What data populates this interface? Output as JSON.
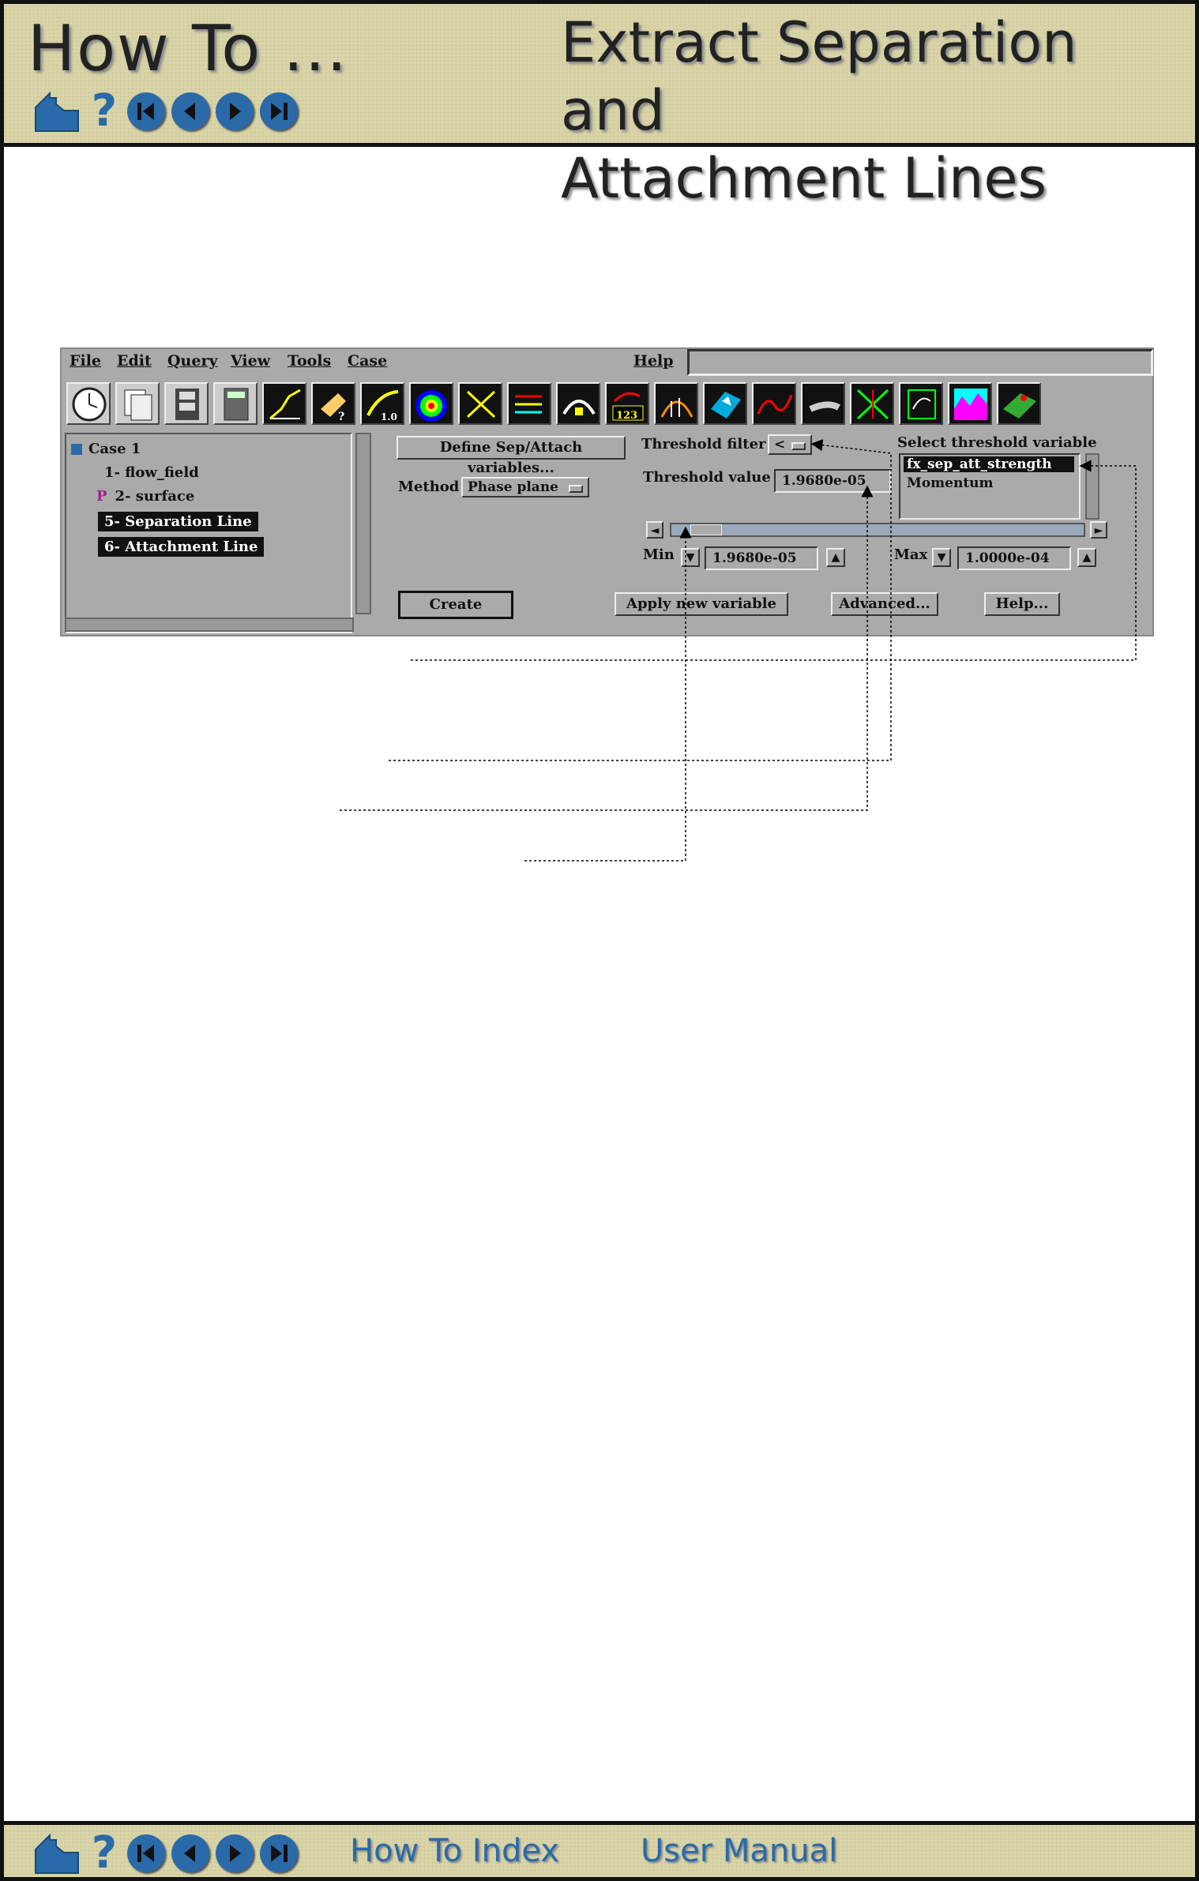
{
  "header": {
    "left_title": "How To ...",
    "right_title_line1": "Extract Separation and",
    "right_title_line2": "Attachment Lines",
    "nav_icons": [
      "home-icon",
      "help-icon",
      "first-page-icon",
      "previous-page-icon",
      "next-page-icon",
      "last-page-icon"
    ]
  },
  "footer": {
    "links": [
      "How To Index",
      "User Manual"
    ]
  },
  "gui": {
    "menus": [
      "File",
      "Edit",
      "Query",
      "View",
      "Tools",
      "Case",
      "Help"
    ],
    "tree": {
      "case": "Case 1",
      "items": [
        {
          "label": "1- flow_field",
          "prefix": ""
        },
        {
          "label": "2- surface",
          "prefix": "P"
        },
        {
          "label": "5- Separation Line",
          "prefix": ""
        },
        {
          "label": "6- Attachment Line",
          "prefix": ""
        }
      ]
    },
    "define_button": "Define Sep/Attach variables...",
    "method_label": "Method",
    "method_value": "Phase plane",
    "threshold_filter_label": "Threshold filter",
    "threshold_filter_value": "<",
    "threshold_value_label": "Threshold value",
    "threshold_value": "1.9680e-05",
    "select_threshold_label": "Select threshold variable",
    "variables": [
      "fx_sep_att_strength",
      "Momentum"
    ],
    "min_label": "Min",
    "min_value": "1.9680e-05",
    "max_label": "Max",
    "max_value": "1.0000e-04",
    "buttons": {
      "create": "Create",
      "apply": "Apply new variable",
      "advanced": "Advanced...",
      "help": "Help..."
    },
    "slider_position": 0.05,
    "colors": {
      "panel": "#aaaaaa",
      "selection": "#111111",
      "accent": "#2a6aa8"
    }
  }
}
